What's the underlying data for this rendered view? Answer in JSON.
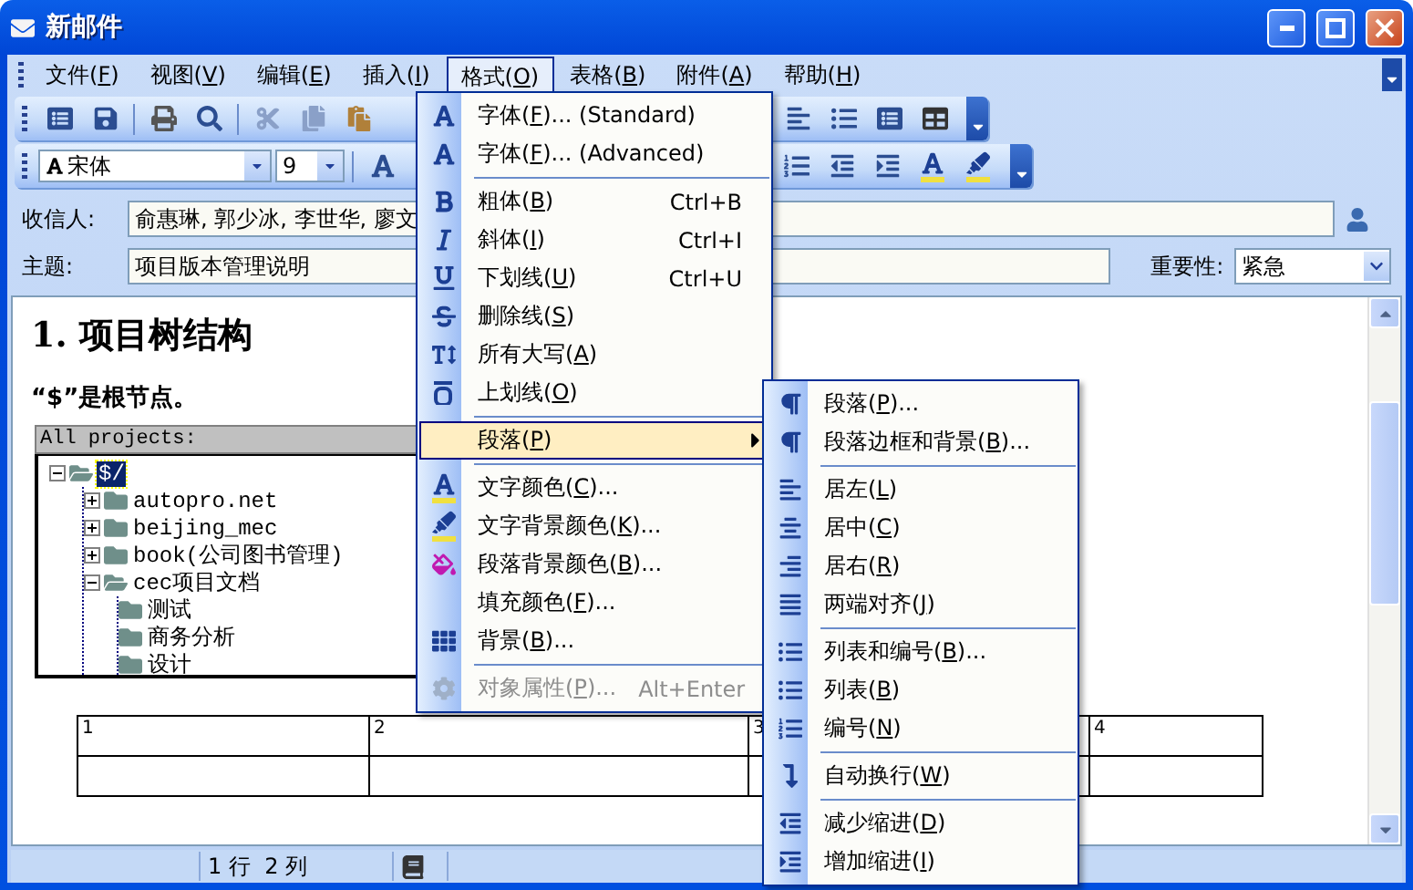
{
  "window": {
    "title": "新邮件"
  },
  "menu_bar": [
    {
      "label": "文件(F)",
      "selected": false
    },
    {
      "label": "视图(V)",
      "selected": false
    },
    {
      "label": "编辑(E)",
      "selected": false
    },
    {
      "label": "插入(I)",
      "selected": false
    },
    {
      "label": "格式(O)",
      "selected": true
    },
    {
      "label": "表格(B)",
      "selected": false
    },
    {
      "label": "附件(A)",
      "selected": false
    },
    {
      "label": "帮助(H)",
      "selected": false
    }
  ],
  "format_toolbar": {
    "font": "宋体",
    "size": "9"
  },
  "header": {
    "to": {
      "label": "收信人:",
      "value": "俞惠琳, 郭少冰, 李世华, 廖文"
    },
    "subject": {
      "label": "主题:",
      "value": "项目版本管理说明"
    },
    "importance": {
      "label": "重要性:",
      "value": "紧急"
    }
  },
  "document": {
    "heading": "1. 项目树结构",
    "note": "“$”是根节点。",
    "tree_view": {
      "title": "All projects:",
      "root": {
        "label": "$/",
        "selected": true,
        "expanded": true,
        "children": [
          {
            "label": "autopro.net",
            "selected": false,
            "expanded": false
          },
          {
            "label": "beijing_mec",
            "selected": false,
            "expanded": false
          },
          {
            "label": "book(公司图书管理)",
            "selected": false,
            "expanded": false
          },
          {
            "label": "cec项目文档",
            "selected": false,
            "expanded": true,
            "children": [
              {
                "label": "测试",
                "selected": false
              },
              {
                "label": "商务分析",
                "selected": false
              },
              {
                "label": "设计",
                "selected": false
              }
            ]
          }
        ]
      }
    },
    "table": {
      "columns": [
        "1",
        "2",
        "3",
        "4"
      ]
    }
  },
  "status_bar": {
    "position": "1 行  2 列"
  },
  "format_menu": {
    "groups": [
      [
        {
          "label": "字体(F)... (Standard)",
          "kind": "command",
          "selected": false,
          "disabled": false
        },
        {
          "label": "字体(F)... (Advanced)",
          "kind": "command",
          "selected": false,
          "disabled": false
        }
      ],
      [
        {
          "label": "粗体(B)",
          "shortcut": "Ctrl+B",
          "kind": "command",
          "selected": false,
          "disabled": false
        },
        {
          "label": "斜体(I)",
          "shortcut": "Ctrl+I",
          "kind": "command",
          "selected": false,
          "disabled": false
        },
        {
          "label": "下划线(U)",
          "shortcut": "Ctrl+U",
          "kind": "command",
          "selected": false,
          "disabled": false
        },
        {
          "label": "删除线(S)",
          "kind": "command",
          "selected": false,
          "disabled": false
        },
        {
          "label": "所有大写(A)",
          "kind": "command",
          "selected": false,
          "disabled": false
        },
        {
          "label": "上划线(O)",
          "kind": "command",
          "selected": false,
          "disabled": false
        }
      ],
      [
        {
          "label": "段落(P)",
          "kind": "submenu",
          "selected": true,
          "disabled": false
        }
      ],
      [
        {
          "label": "文字颜色(C)...",
          "kind": "command",
          "selected": false,
          "disabled": false
        },
        {
          "label": "文字背景颜色(K)...",
          "kind": "command",
          "selected": false,
          "disabled": false
        },
        {
          "label": "段落背景颜色(B)...",
          "kind": "command",
          "selected": false,
          "disabled": false
        },
        {
          "label": "填充颜色(F)...",
          "kind": "command",
          "selected": false,
          "disabled": false
        },
        {
          "label": "背景(B)...",
          "kind": "command",
          "selected": false,
          "disabled": false
        }
      ],
      [
        {
          "label": "对象属性(P)...",
          "shortcut": "Alt+Enter",
          "kind": "command",
          "selected": false,
          "disabled": true
        }
      ]
    ]
  },
  "paragraph_submenu": {
    "groups": [
      [
        {
          "label": "段落(P)..."
        },
        {
          "label": "段落边框和背景(B)..."
        }
      ],
      [
        {
          "label": "居左(L)"
        },
        {
          "label": "居中(C)"
        },
        {
          "label": "居右(R)"
        },
        {
          "label": "两端对齐(J)"
        }
      ],
      [
        {
          "label": "列表和编号(B)..."
        },
        {
          "label": "列表(B)"
        },
        {
          "label": "编号(N)"
        }
      ],
      [
        {
          "label": "自动换行(W)"
        }
      ],
      [
        {
          "label": "减少缩进(D)"
        },
        {
          "label": "增加缩进(I)"
        }
      ]
    ]
  }
}
